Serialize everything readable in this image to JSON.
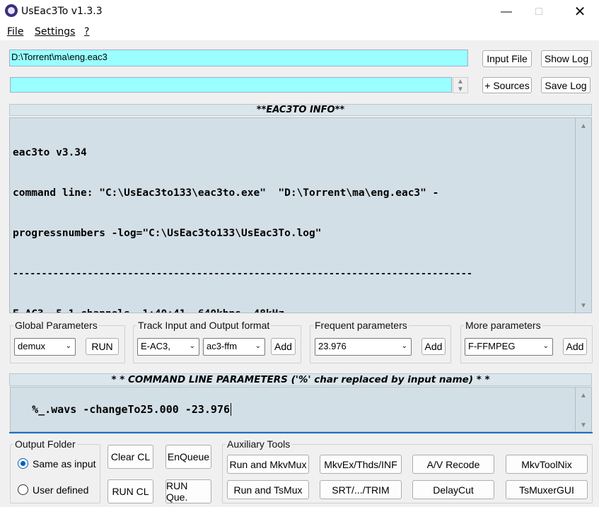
{
  "window": {
    "title": "UsEac3To v1.3.3",
    "minimize_icon": "minimize-icon",
    "maximize_icon": "maximize-icon",
    "close_icon": "close-icon"
  },
  "menu": [
    {
      "label": "File"
    },
    {
      "label": "Settings"
    },
    {
      "label": "?"
    }
  ],
  "input_path": "D:\\Torrent\\ma\\eng.eac3",
  "input_file_button": "Input File",
  "show_log_button": "Show Log",
  "sources_field": "",
  "sources_button": "+ Sources",
  "save_log_button": "Save Log",
  "info": {
    "header": "**EAC3TO INFO**",
    "lines": [
      "eac3to v3.34",
      "command line: \"C:\\UsEac3to133\\eac3to.exe\"  \"D:\\Torrent\\ma\\eng.eac3\" -",
      "progressnumbers -log=\"C:\\UsEac3to133\\UsEac3To.log\"",
      "--------------------------------------------------------------------------------",
      "E-AC3, 5.1 channels, 1:40:41, 640kbps, 48kHz"
    ]
  },
  "global_params": {
    "legend": "Global Parameters",
    "select": "demux",
    "run_button": "RUN"
  },
  "track_format": {
    "legend": "Track Input and Output format",
    "input_select": "E-AC3,",
    "output_select": "ac3-ffm",
    "add_button": "Add"
  },
  "frequent_params": {
    "legend": "Frequent parameters",
    "select": "23.976",
    "add_button": "Add"
  },
  "more_params": {
    "legend": "More parameters",
    "select": "F-FFMPEG",
    "add_button": "Add"
  },
  "command_line": {
    "header": "* * COMMAND LINE PARAMETERS ('%' char replaced by input name) * *",
    "value": "%_.wavs -changeTo25.000 -23.976"
  },
  "output_folder": {
    "legend": "Output Folder",
    "option_same": "Same as input",
    "option_user": "User defined",
    "selected": "Same as input"
  },
  "buttons": {
    "clear_cl": "Clear CL",
    "enqueue": "EnQueue",
    "run_cl": "RUN CL",
    "run_queue": "RUN Que."
  },
  "aux": {
    "legend": "Auxiliary Tools",
    "run_mkvmux": "Run and MkvMux",
    "mkvex": "MkvEx/Thds/INF",
    "av_recode": "A/V Recode",
    "mkvtoolnix": "MkvToolNix",
    "run_tsmux": "Run and TsMux",
    "srt_trim": "SRT/.../TRIM",
    "delaycut": "DelayCut",
    "tsmuxergui": "TsMuxerGUI"
  },
  "colors": {
    "field_cyan": "#99ffff",
    "pane_blue": "#d3dfe6",
    "accent": "#005fb8"
  }
}
